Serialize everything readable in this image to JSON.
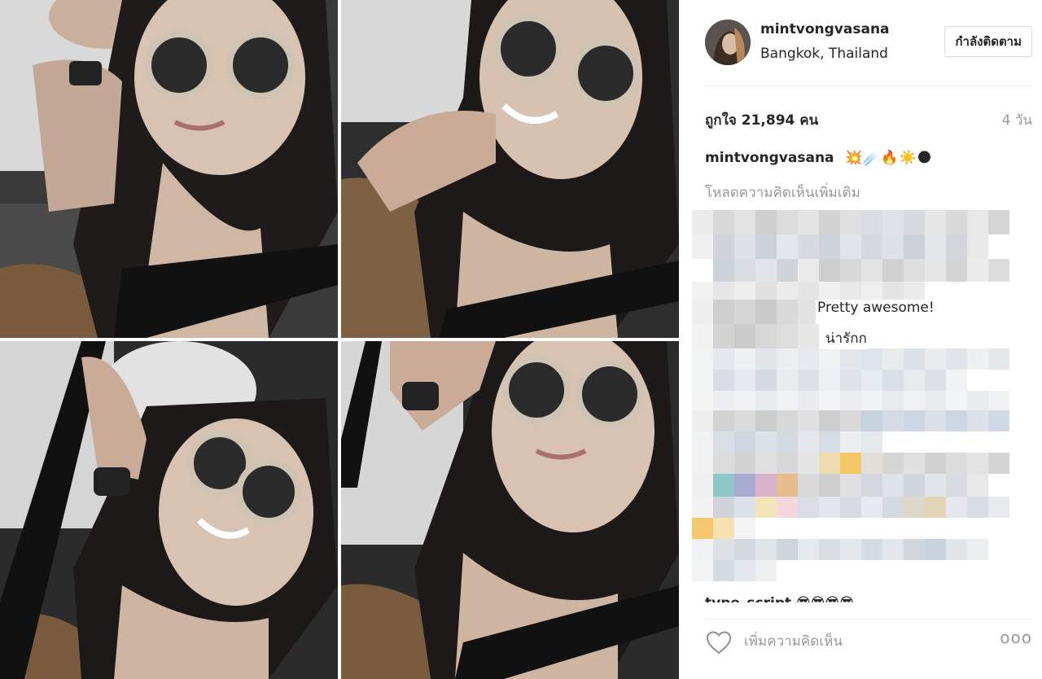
{
  "post": {
    "username": "mintvongvasana",
    "location": "Bangkok, Thailand",
    "follow_label": "กำลังติดตาม",
    "likes": "ถูกใจ 21,894 คน",
    "time_ago": "4 วัน",
    "caption_user": "mintvongvasana",
    "caption_emoji": "💥☄️🔥☀️🌑",
    "load_more": "โหลดความคิดเห็นเพิ่มเติม",
    "comments": [
      "Pretty awesome!",
      "น่ารักก"
    ],
    "cut_line": "type_script 😎😎😎😎",
    "comment_placeholder": "เพิ่มความคิดเห็น",
    "more_label": "ooo"
  },
  "icons": {
    "like": "heart-icon",
    "options": "more-options-icon"
  },
  "colors": {
    "text": "#262626",
    "secondary": "#999999",
    "border": "#dbdbdb"
  }
}
